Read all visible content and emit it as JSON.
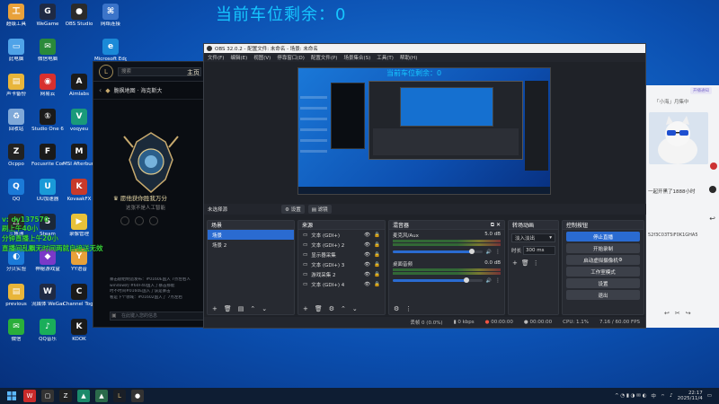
{
  "overlay": {
    "parking_text": "当前车位剩余：0",
    "preview_parking_text": "当前车位剩余：0",
    "stream_lines": [
      "v: dy137570",
      "刷上午40小",
      "分钟直播上午20小",
      "直播间乱飘无时间两就自接送无效"
    ]
  },
  "desktop_icons": [
    {
      "label": "超级工具",
      "icon": "tool-icon",
      "color": "#e8a13a",
      "glyph": "工"
    },
    {
      "label": "WeGame",
      "icon": "wegame-icon",
      "color": "#1f2a44",
      "glyph": "G"
    },
    {
      "label": "OBS Studio",
      "icon": "obs-icon",
      "color": "#2b2b2b",
      "glyph": "●"
    },
    {
      "label": "网络连接",
      "icon": "network-icon",
      "color": "#3b74c9",
      "glyph": "⌘"
    },
    {
      "label": "此电脑",
      "icon": "computer-icon",
      "color": "#4fa3e8",
      "glyph": "▭"
    },
    {
      "label": "微信电脑",
      "icon": "wechat-pc-icon",
      "color": "#2a8a3a",
      "glyph": "✉"
    },
    {
      "label": "Microsoft Edge",
      "icon": "edge-icon",
      "color": "#1b8ad8",
      "glyph": "e"
    },
    {
      "label": "声卡备份",
      "icon": "folder-icon",
      "color": "#e8b53a",
      "glyph": "▤"
    },
    {
      "label": "网易云",
      "icon": "netease-icon",
      "color": "#d8302e",
      "glyph": "◉"
    },
    {
      "label": "Aimlabs",
      "icon": "aimlabs-icon",
      "color": "#1b1b1b",
      "glyph": "A"
    },
    {
      "label": "回收站",
      "icon": "recycle-bin-icon",
      "color": "#7fa8d8",
      "glyph": "♻"
    },
    {
      "label": "Studio One 6",
      "icon": "studio-one-icon",
      "color": "#1a1a1a",
      "glyph": "①"
    },
    {
      "label": "voqyeu",
      "icon": "voqyeu-icon",
      "color": "#1a9a7a",
      "glyph": "V"
    },
    {
      "label": "Ocppo",
      "icon": "ocppo-icon",
      "color": "#222",
      "glyph": "Z"
    },
    {
      "label": "Focusrite Control",
      "icon": "focusrite-icon",
      "color": "#1a1a1a",
      "glyph": "F"
    },
    {
      "label": "MSI Afterburner",
      "icon": "msi-icon",
      "color": "#1a1a1a",
      "glyph": "M"
    },
    {
      "label": "QQ",
      "icon": "qq-icon",
      "color": "#1b7ad8",
      "glyph": "Q"
    },
    {
      "label": "UU加速器",
      "icon": "uu-icon",
      "color": "#1a9ad8",
      "glyph": "U"
    },
    {
      "label": "KovaakFX",
      "icon": "kovaak-icon",
      "color": "#c83a2a",
      "glyph": "K"
    },
    {
      "label": "三角洲",
      "icon": "delta-icon",
      "color": "#2a2a2a",
      "glyph": "△"
    },
    {
      "label": "Steam",
      "icon": "steam-icon",
      "color": "#1b2838",
      "glyph": "S"
    },
    {
      "label": "录像管理",
      "icon": "recorder-icon",
      "color": "#e8c23a",
      "glyph": "▶"
    },
    {
      "label": "分贝实验",
      "icon": "decibel-icon",
      "color": "#1b7ad8",
      "glyph": "◐"
    },
    {
      "label": "神秘游戏盒",
      "icon": "game-box-icon",
      "color": "#7a3ac8",
      "glyph": "◆"
    },
    {
      "label": "YY语音",
      "icon": "yy-icon",
      "color": "#e8a13a",
      "glyph": "Y"
    },
    {
      "label": "previous",
      "icon": "folder-icon",
      "color": "#e8b53a",
      "glyph": "▤"
    },
    {
      "label": "流媒体 WeGame版",
      "icon": "streaming-icon",
      "color": "#1f2a44",
      "glyph": "W"
    },
    {
      "label": "Channel Together",
      "icon": "channel-icon",
      "color": "#1a1a1a",
      "glyph": "C"
    },
    {
      "label": "微信",
      "icon": "wechat-icon",
      "color": "#2aae3a",
      "glyph": "✉"
    },
    {
      "label": "QQ音乐",
      "icon": "qq-music-icon",
      "color": "#1aae5a",
      "glyph": "♪"
    },
    {
      "label": "KOOK",
      "icon": "kook-icon",
      "color": "#1a1a1a",
      "glyph": "K"
    }
  ],
  "lol": {
    "search_placeholder": "搜索",
    "home_tab": "主页",
    "map_title": "脆枫地图 · 海克斯大",
    "quote": "愿他获你胜我万分",
    "subquote": "这张不是人工智能",
    "chat_lines": [
      "暴击剧组制造发布：#0160E国入 7点左右人",
      "window的 #60F40国入了暴击那能",
      "时不时间#0160E国入了该是暴击",
      "看是下个领域：#01602国入了 7点左右"
    ],
    "chat_placeholder": "在此键入您的信息"
  },
  "obs": {
    "title": "OBS 32.0.2 - 配置文件: 未命名 - 场景: 未命名",
    "menu": [
      "文件(F)",
      "编辑(E)",
      "视图(V)",
      "停靠窗口(D)",
      "配置文件(P)",
      "场景集合(S)",
      "工具(T)",
      "帮助(H)"
    ],
    "source_status": "未选择源",
    "properties_btn": "设置",
    "filters_btn": "滤镜",
    "scenes_header": "场景",
    "scenes": [
      "场景",
      "场景 2"
    ],
    "sources_header": "来源",
    "sources": [
      "文本 (GDI+)",
      "文本 (GDI+) 2",
      "显示器采集",
      "文本 (GDI+) 3",
      "游戏采集 2",
      "文本 (GDI+) 4"
    ],
    "mixer_header": "混音器",
    "mixer": [
      {
        "name": "麦克风/Aux",
        "db": "5.0 dB",
        "level": 0.88
      },
      {
        "name": "桌面音频",
        "db": "0.0 dB",
        "level": 0.82
      }
    ],
    "transitions_header": "转场动画",
    "transition_type": "淡入淡出",
    "duration_label": "时长",
    "duration_value": "300 ms",
    "controls_header": "控制按钮",
    "controls": [
      "停止直播",
      "开始录制",
      "启动虚拟摄像机",
      "工作室模式",
      "设置",
      "退出"
    ],
    "status": {
      "frames": "丢帧 0 (0.0%)",
      "kbps": "0 kbps",
      "live_time": "00:00:00",
      "rec_time": "00:00:00",
      "cpu": "CPU: 1.1%",
      "fps": "7.16 / 60.00 FPS"
    }
  },
  "chat_panel": {
    "header": "「小海」月集中",
    "badge": "开播通知",
    "message": "一起开黑了1888小时",
    "code": "52f3C03T5iF0K1GHA5"
  },
  "taskbar": {
    "time": "22:17",
    "date": "2025/11/4",
    "ime": "中"
  },
  "colors": {
    "accent": "#2a6bd1",
    "overlay_cyan": "#16c6ff",
    "overlay_green": "#39d33a"
  }
}
